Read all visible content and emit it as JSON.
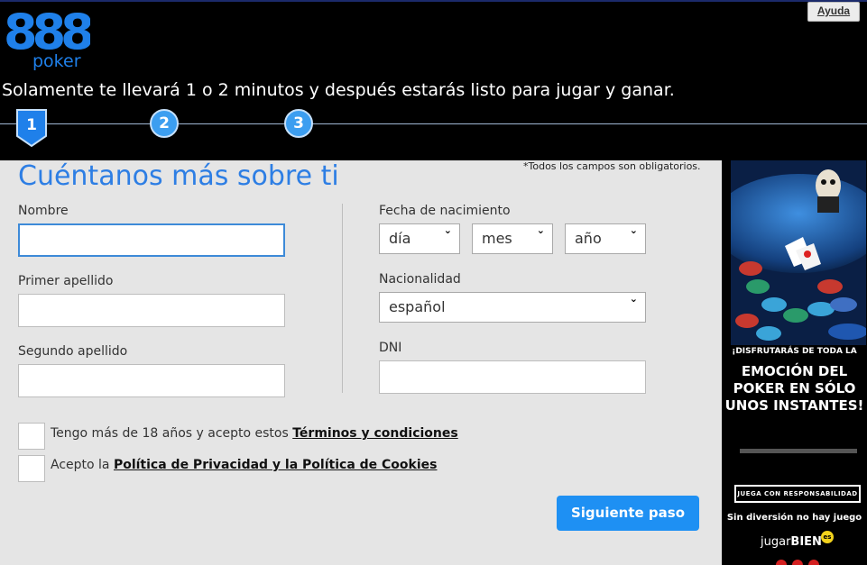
{
  "header": {
    "logo_number": "888",
    "logo_word": "poker",
    "help_label": "Ayuda",
    "tagline": "Solamente te llevará 1 o 2 minutos y después estarás listo para jugar y ganar."
  },
  "steps": [
    "1",
    "2",
    "3"
  ],
  "form": {
    "title": "Cuéntanos más sobre ti",
    "required_note": "*Todos los campos son obligatorios.",
    "nombre_label": "Nombre",
    "primer_apellido_label": "Primer apellido",
    "segundo_apellido_label": "Segundo apellido",
    "fecha_label": "Fecha de nacimiento",
    "dia_value": "día",
    "mes_value": "mes",
    "ano_value": "año",
    "nacionalidad_label": "Nacionalidad",
    "nacionalidad_value": "español",
    "dni_label": "DNI",
    "terms_text": "Tengo más de 18 años y acepto estos ",
    "terms_link": "Términos y condiciones",
    "privacy_text": "Acepto la ",
    "privacy_link": "Política de Privacidad y la Política de Cookies",
    "next_button": "Siguiente paso"
  },
  "promo": {
    "small_text": "¡DISFRUTARÁS DE TODA LA",
    "big_text": "EMOCIÓN DEL POKER EN SÓLO UNOS INSTANTES!",
    "responsible_label": "JUEGA CON RESPONSABILIDAD",
    "fun_text": "Sin diversión no hay juego",
    "jugar_text": "jugar",
    "bien_text": "BIEN",
    "bien_sup": "es"
  },
  "colors": {
    "brand_blue": "#2d7ee4",
    "button_blue": "#1e90f3",
    "step_blue": "#3c9ef0"
  }
}
